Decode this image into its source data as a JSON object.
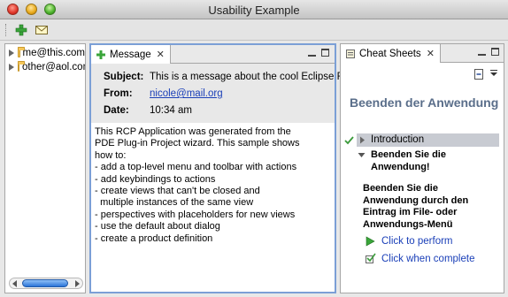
{
  "window": {
    "title": "Usability Example"
  },
  "toolbar": {
    "buttons": [
      {
        "icon": "new-icon"
      },
      {
        "icon": "mail-icon"
      }
    ]
  },
  "navigator": {
    "items": [
      {
        "label": "me@this.com"
      },
      {
        "label": "other@aol.com"
      }
    ]
  },
  "message_view": {
    "tab_label": "Message",
    "subject_label": "Subject:",
    "subject_value": "This is a message about the cool Eclipse RCP!",
    "from_label": "From:",
    "from_value": "nicole@mail.org",
    "date_label": "Date:",
    "date_value": "10:34 am",
    "body": "This RCP Application was generated from the\nPDE Plug-in Project wizard. This sample shows\nhow to:\n- add a top-level menu and toolbar with actions\n- add keybindings to actions\n- create views that can't be closed and\n  multiple instances of the same view\n- perspectives with placeholders for new views\n- use the default about dialog\n- create a product definition"
  },
  "cheat_sheets": {
    "tab_label": "Cheat Sheets",
    "title": "Beenden der Anwendung",
    "intro_label": "Introduction",
    "step_title": "Beenden Sie die Anwendung!",
    "step_desc": "Beenden Sie die Anwendung durch den Eintrag im File- oder Anwendungs-Menü",
    "perform_label": "Click to perform",
    "complete_label": "Click when complete"
  },
  "colors": {
    "accent": "#7b9fd6",
    "link": "#1a3fb8",
    "cheat_title": "#5a6e8a"
  }
}
